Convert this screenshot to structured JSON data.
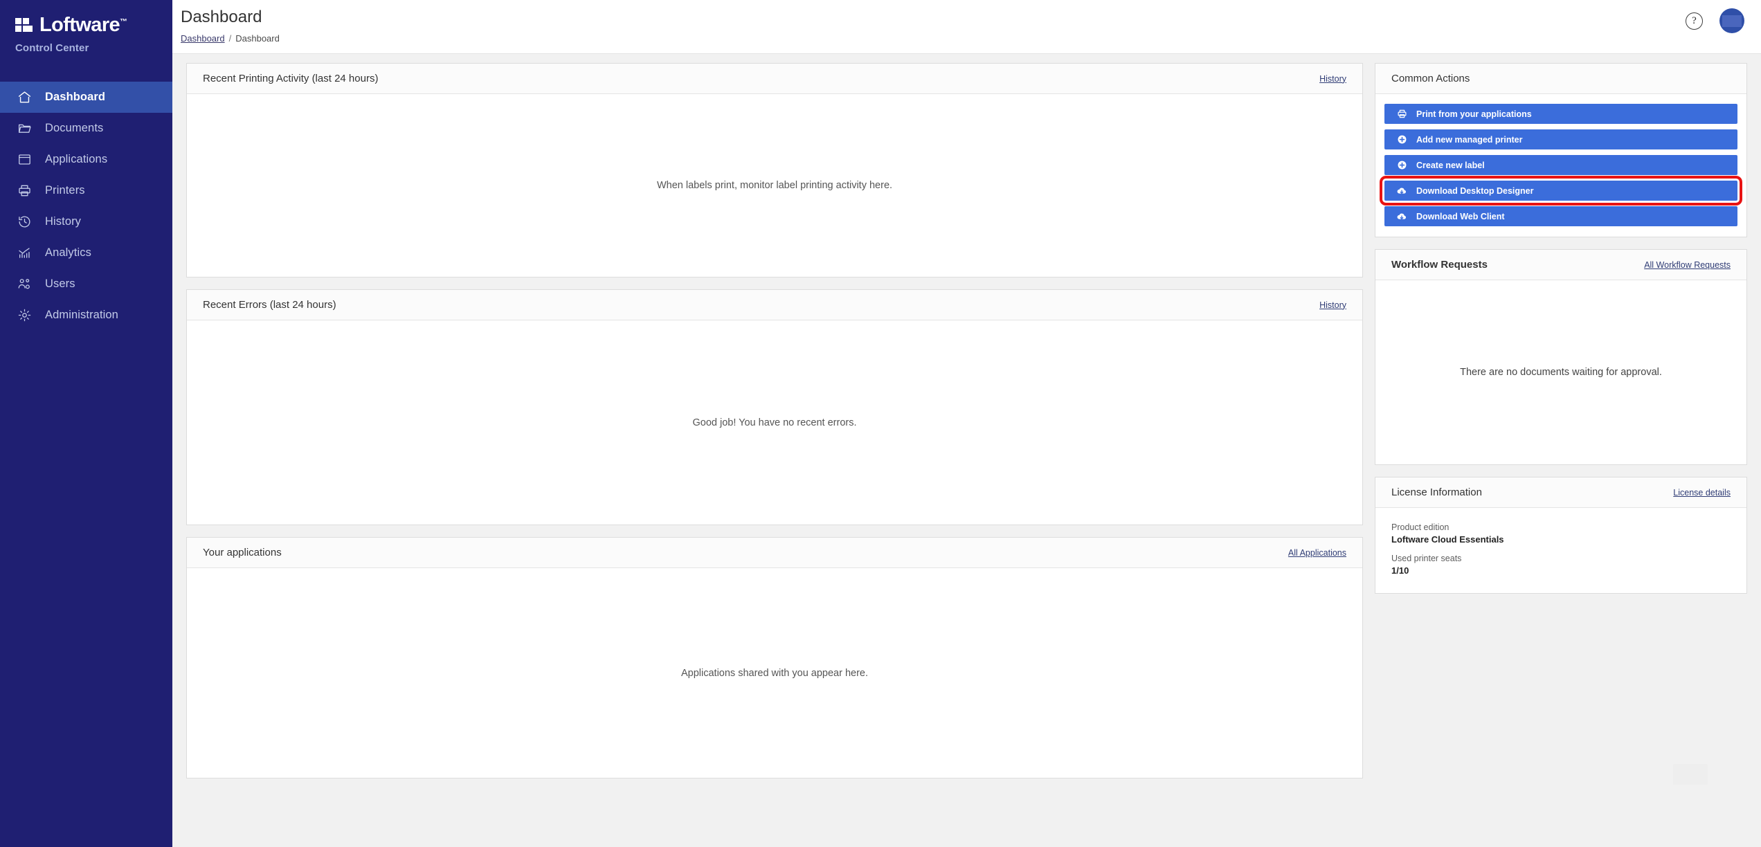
{
  "brand": {
    "name": "Loftware",
    "trademark": "™",
    "subtitle": "Control Center",
    "logo_icon": "loftware-squares-logo",
    "sidebar_color": "#1f1f72",
    "active_item_color": "#3350a8"
  },
  "sidebar": {
    "items": [
      {
        "label": "Dashboard",
        "icon": "home-icon",
        "active": true
      },
      {
        "label": "Documents",
        "icon": "folder-icon",
        "active": false
      },
      {
        "label": "Applications",
        "icon": "window-icon",
        "active": false
      },
      {
        "label": "Printers",
        "icon": "printer-icon",
        "active": false
      },
      {
        "label": "History",
        "icon": "clock-back-icon",
        "active": false
      },
      {
        "label": "Analytics",
        "icon": "bar-chart-icon",
        "active": false
      },
      {
        "label": "Users",
        "icon": "users-gear-icon",
        "active": false
      },
      {
        "label": "Administration",
        "icon": "gear-icon",
        "active": false
      }
    ]
  },
  "topbar": {
    "title": "Dashboard",
    "breadcrumb": {
      "root": "Dashboard",
      "separator": "/",
      "current": "Dashboard"
    },
    "help_icon": "question-mark-circle-icon",
    "help_glyph": "?",
    "avatar_icon": "user-avatar"
  },
  "main": {
    "printing_activity": {
      "title": "Recent Printing Activity (last 24 hours)",
      "link": "History",
      "empty_message": "When labels print, monitor label printing activity here."
    },
    "recent_errors": {
      "title": "Recent Errors (last 24 hours)",
      "link": "History",
      "empty_message": "Good job! You have no recent errors."
    },
    "your_applications": {
      "title": "Your applications",
      "link": "All Applications",
      "empty_message": "Applications shared with you appear here."
    }
  },
  "common_actions": {
    "title": "Common Actions",
    "accent_color": "#3b6ddb",
    "highlight_color": "#e81313",
    "buttons": [
      {
        "label": "Print from your applications",
        "icon": "printer-icon",
        "highlighted": false
      },
      {
        "label": "Add new managed printer",
        "icon": "plus-circle-icon",
        "highlighted": false
      },
      {
        "label": "Create new label",
        "icon": "plus-circle-icon",
        "highlighted": false
      },
      {
        "label": "Download Desktop Designer",
        "icon": "cloud-download-icon",
        "highlighted": true
      },
      {
        "label": "Download Web Client",
        "icon": "cloud-download-icon",
        "highlighted": false
      }
    ]
  },
  "workflow_requests": {
    "title": "Workflow Requests",
    "link": "All Workflow Requests",
    "empty_message": "There are no documents waiting for approval."
  },
  "license_information": {
    "title": "License Information",
    "link": "License details",
    "fields": [
      {
        "label": "Product edition",
        "value": "Loftware Cloud Essentials"
      },
      {
        "label": "Used printer seats",
        "value": "1/10"
      }
    ]
  }
}
